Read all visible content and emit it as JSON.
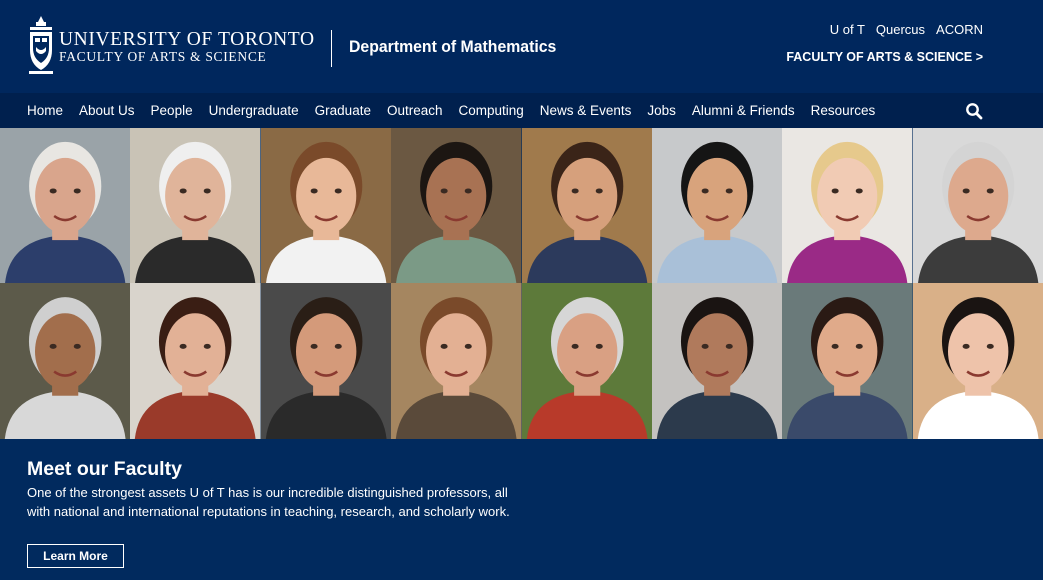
{
  "header": {
    "university": "UNIVERSITY OF TORONTO",
    "faculty": "FACULTY OF ARTS & SCIENCE",
    "department": "Department of Mathematics",
    "utility_links": [
      "U of T",
      "Quercus",
      "ACORN"
    ],
    "faculty_link": "FACULTY OF ARTS & SCIENCE >"
  },
  "nav": {
    "items": [
      "Home",
      "About Us",
      "People",
      "Undergraduate",
      "Graduate",
      "Outreach",
      "Computing",
      "News & Events",
      "Jobs",
      "Alumni & Friends",
      "Resources"
    ],
    "search_icon": "search-icon"
  },
  "faculty_photos": {
    "count": 16,
    "description_icons": "portrait"
  },
  "promo": {
    "title": "Meet our Faculty",
    "text": "One of the strongest assets U of T has is our incredible distinguished professors, all with national and international reputations in teaching, research, and scholarly work.",
    "button": "Learn More"
  },
  "colors": {
    "header_bg": "#00275d",
    "nav_bg": "#00204e",
    "promo_bg": "#012a5e",
    "text": "#ffffff"
  }
}
